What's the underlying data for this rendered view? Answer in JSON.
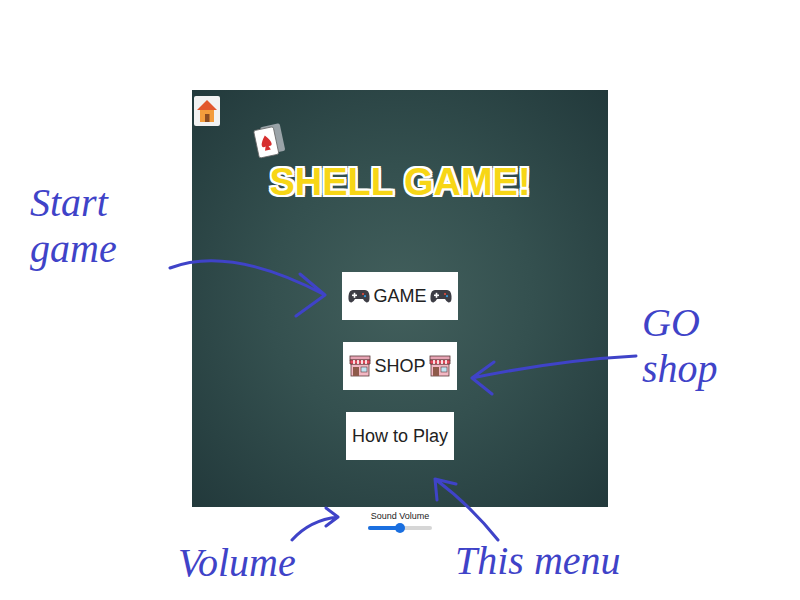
{
  "title": "SHELL GAME!",
  "menu": [
    {
      "label": "GAME",
      "kind": "game"
    },
    {
      "label": "SHOP",
      "kind": "shop"
    },
    {
      "label": "How to Play",
      "kind": "plain"
    }
  ],
  "volume": {
    "label": "Sound Volume",
    "level": 0.5
  },
  "annotations": [
    {
      "text": "Start game"
    },
    {
      "text": "GO shop"
    },
    {
      "text": "Volume"
    },
    {
      "text": "This menu"
    }
  ]
}
